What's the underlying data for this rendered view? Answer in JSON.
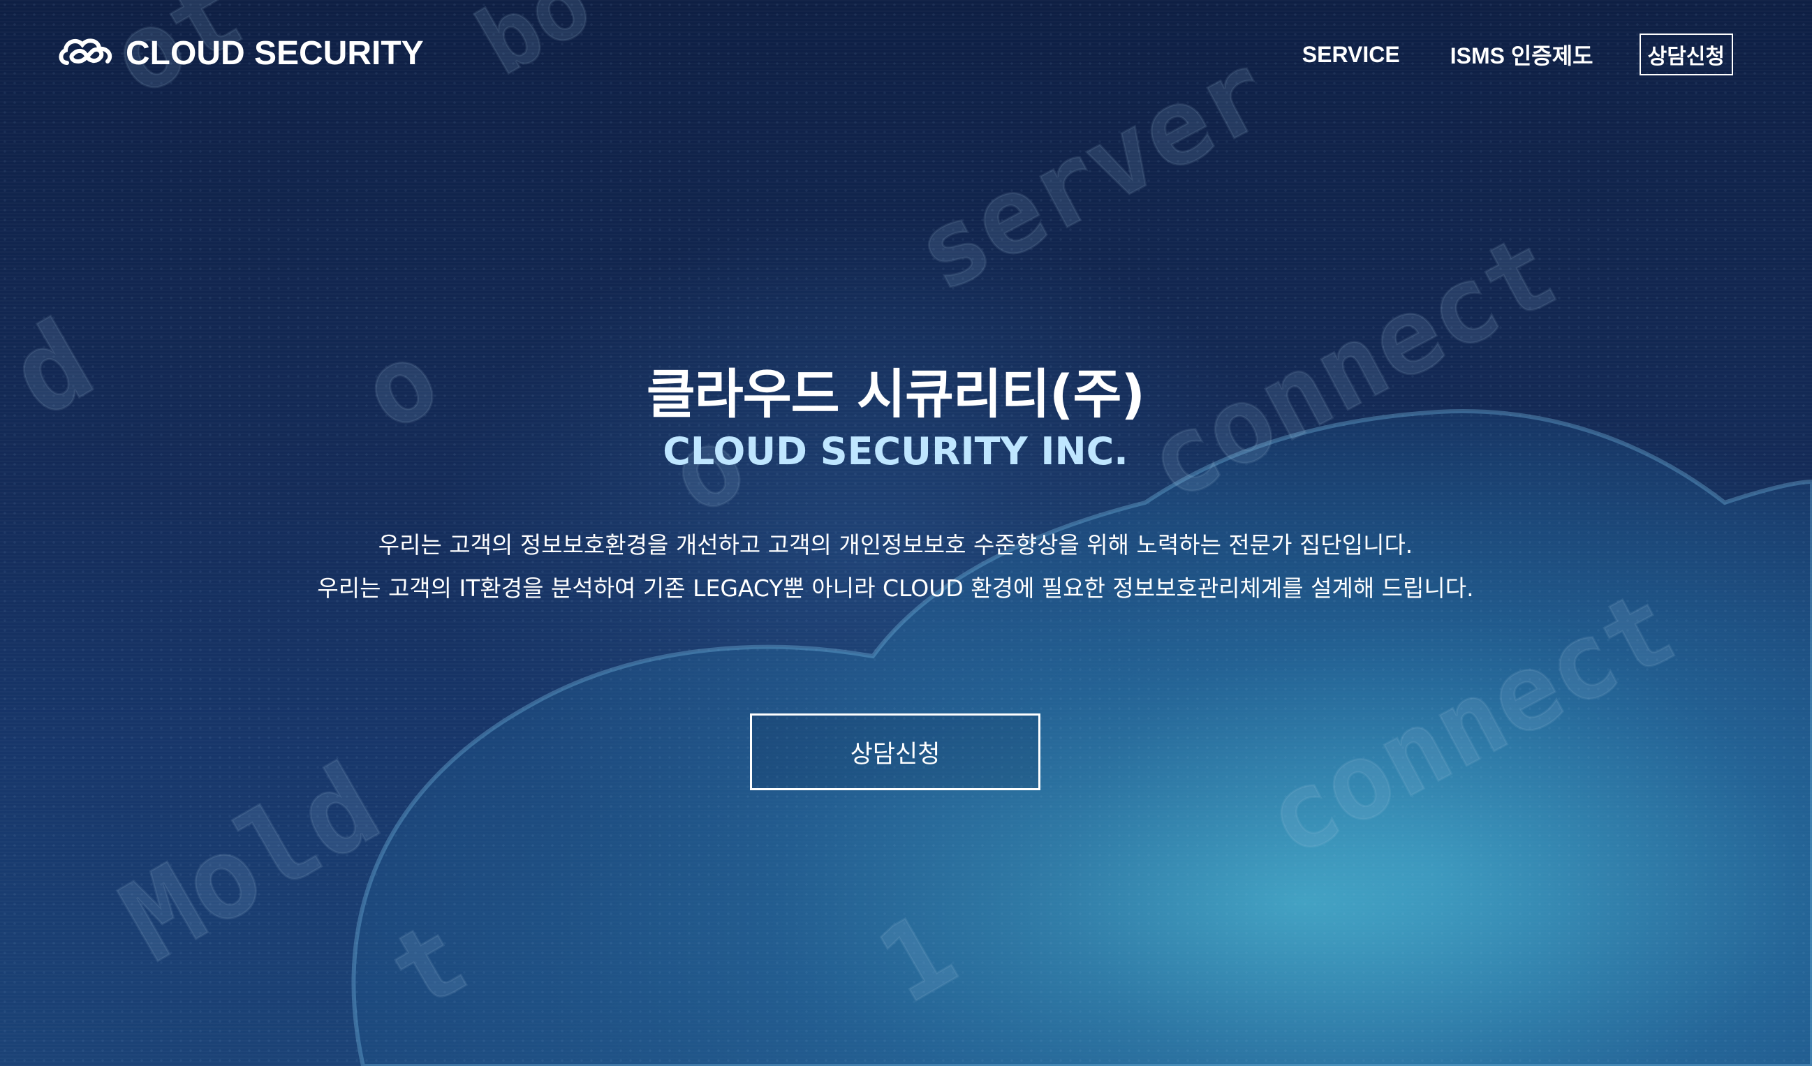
{
  "header": {
    "logo_text": "CLOUD SECURITY",
    "nav": [
      {
        "label": "SERVICE"
      },
      {
        "label": "ISMS 인증제도"
      }
    ],
    "cta_label": "상담신청"
  },
  "hero": {
    "title_ko": "클라우드 시큐리티(주)",
    "title_en": "CLOUD SECURITY INC.",
    "description": [
      "우리는 고객의 정보보호환경을 개선하고 고객의 개인정보보호 수준향상을 위해 노력하는 전문가 집단입니다.",
      "우리는 고객의 IT환경을 분석하여 기존 LEGACY뿐 아니라 CLOUD 환경에 필요한 정보보호관리체계를 설계해 드립니다."
    ],
    "cta_label": "상담신청"
  },
  "colors": {
    "background_dark": "#0e1f44",
    "background_light": "#3896be",
    "accent_title": "#bfe6ff",
    "text": "#ffffff"
  },
  "icons": {
    "logo": "cloud-infinity-icon"
  }
}
